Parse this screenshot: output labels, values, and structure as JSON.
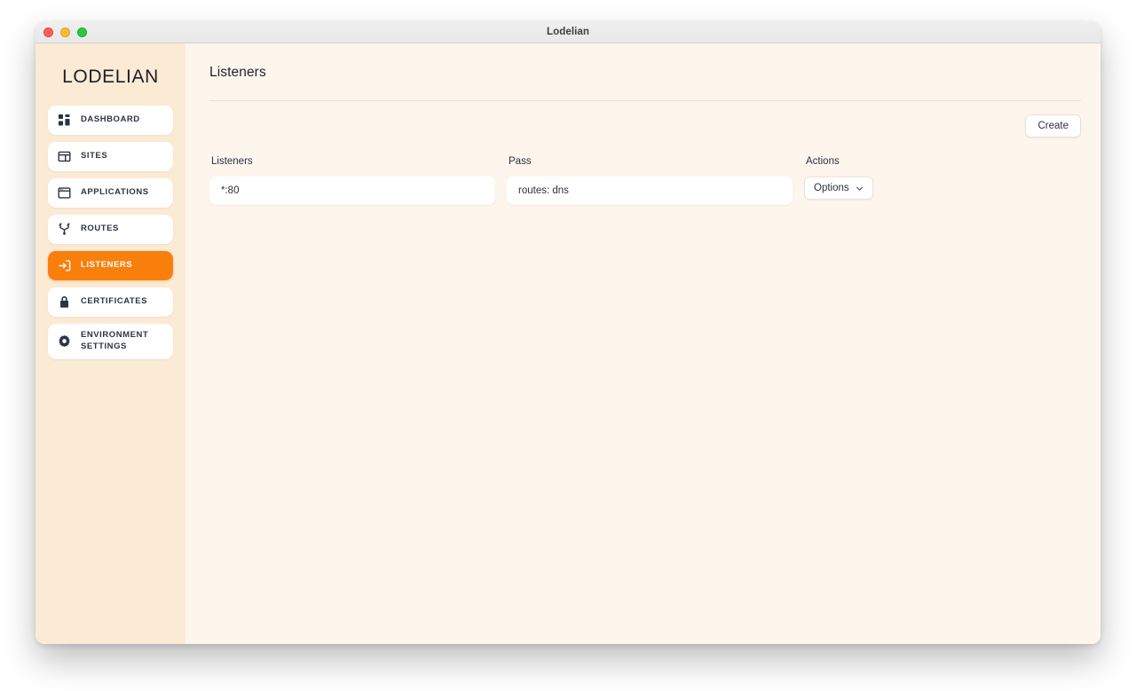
{
  "window": {
    "title": "Lodelian",
    "traffic_lights": [
      "close-button",
      "minimize-button",
      "zoom-button"
    ]
  },
  "sidebar": {
    "brand": "LODELIAN",
    "items": [
      {
        "label": "DASHBOARD",
        "icon": "grid-icon",
        "active": false
      },
      {
        "label": "SITES",
        "icon": "layout-icon",
        "active": false
      },
      {
        "label": "APPLICATIONS",
        "icon": "browser-window-icon",
        "active": false
      },
      {
        "label": "ROUTES",
        "icon": "git-branch-icon",
        "active": false
      },
      {
        "label": "LISTENERS",
        "icon": "login-arrow-icon",
        "active": true
      },
      {
        "label": "CERTIFICATES",
        "icon": "lock-icon",
        "active": false
      },
      {
        "label": "ENVIRONMENT SETTINGS",
        "icon": "gear-icon",
        "active": false
      }
    ]
  },
  "main": {
    "page_title": "Listeners",
    "create_button": "Create",
    "table": {
      "columns": [
        "Listeners",
        "Pass",
        "Actions"
      ],
      "rows": [
        {
          "listeners": "*:80",
          "pass": "routes: dns",
          "action": "Options"
        }
      ]
    }
  },
  "colors": {
    "accent": "#f97f0c",
    "sidebar_bg": "#fcebd4",
    "main_bg": "#fef6ec",
    "card_bg": "#ffffff",
    "text": "#2b3142"
  }
}
